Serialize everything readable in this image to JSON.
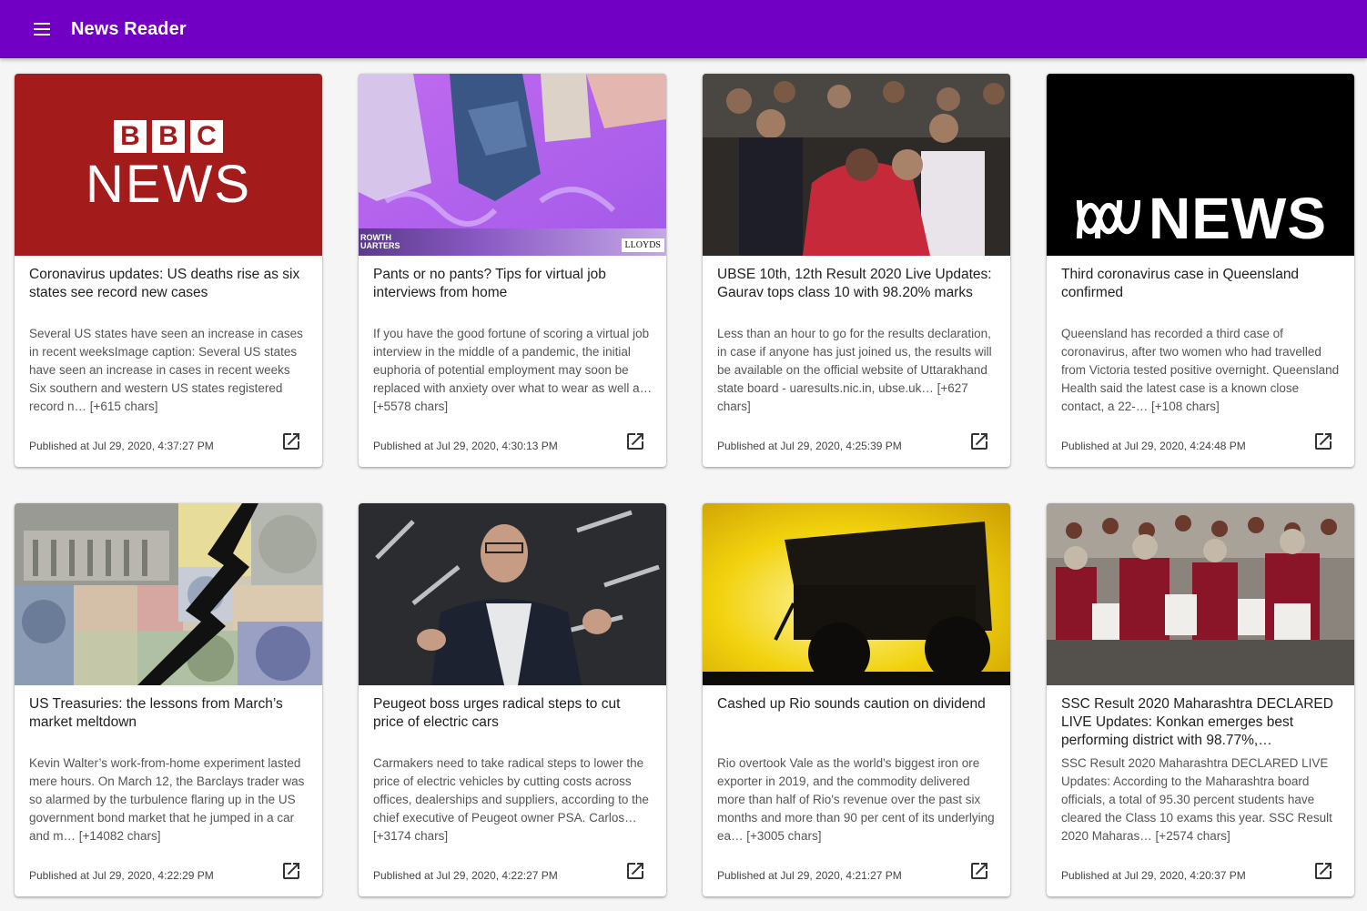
{
  "app": {
    "title": "News Reader",
    "accent": "#7200c4"
  },
  "articles": [
    {
      "title": "Coronavirus updates: US deaths rise as six states see record new cases",
      "description": "Several US states have seen an increase in cases in recent weeksImage caption: Several US states have seen an increase in cases in recent weeks Six southern and western US states registered record n… [+615 chars]",
      "published": "Published at Jul 29, 2020, 4:37:27 PM",
      "image_logo": {
        "blocks": [
          "B",
          "B",
          "C"
        ],
        "word": "NEWS"
      }
    },
    {
      "title": "Pants or no pants? Tips for virtual job interviews from home",
      "description": "If you have the good fortune of scoring a virtual job interview in the middle of a pandemic, the initial euphoria of potential employment may soon be replaced with anxiety over what to wear as well a… [+5578 chars]",
      "published": "Published at Jul 29, 2020, 4:30:13 PM",
      "image_logo": {
        "left": "ROWTH\nUARTERS",
        "right": "LLOYDS"
      }
    },
    {
      "title": "UBSE 10th, 12th Result 2020 Live Updates: Gaurav tops class 10 with 98.20% marks",
      "description": "Less than an hour to go for the results declaration, in case if anyone has just joined us, the results will be available on the official website of Uttarakhand state board - uaresults.nic.in, ubse.uk… [+627 chars]",
      "published": "Published at Jul 29, 2020, 4:25:39 PM"
    },
    {
      "title": "Third coronavirus case in Queensland confirmed",
      "description": "Queensland has recorded a third case of coronavirus, after two women who had travelled from Victoria tested positive overnight. Queensland Health said the latest case is a known close contact, a 22-… [+108 chars]",
      "published": "Published at Jul 29, 2020, 4:24:48 PM",
      "image_logo": {
        "word": "NEWS"
      }
    },
    {
      "title": "US Treasuries: the lessons from March’s market meltdown",
      "description": "Kevin Walter’s work-from-home experiment lasted mere hours. On March 12, the Barclays trader was so alarmed by the turbulence flaring up in the US government bond market that he jumped in a car and m… [+14082 chars]",
      "published": "Published at Jul 29, 2020, 4:22:29 PM"
    },
    {
      "title": "Peugeot boss urges radical steps to cut price of electric cars",
      "description": "Carmakers need to take radical steps to lower the price of electric vehicles by cutting costs across offices, dealerships and suppliers, according to the chief executive of Peugeot owner PSA. Carlos… [+3174 chars]",
      "published": "Published at Jul 29, 2020, 4:22:27 PM"
    },
    {
      "title": "Cashed up Rio sounds caution on dividend",
      "description": "Rio overtook Vale as the world's biggest iron ore exporter in 2019, and the commodity delivered more than half of Rio's revenue over the past six months and more than 90 per cent of its underlying ea… [+3005 chars]",
      "published": "Published at Jul 29, 2020, 4:21:27 PM"
    },
    {
      "title": "SSC Result 2020 Maharashtra DECLARED LIVE Updates: Konkan emerges best performing district with 98.77%,…",
      "description": "SSC Result 2020 Maharashtra DECLARED LIVE Updates: According to the Maharashtra board officials, a total of 95.30 percent students have cleared the Class 10 exams this year. SSC Result 2020 Maharas… [+2574 chars]",
      "published": "Published at Jul 29, 2020, 4:20:37 PM"
    }
  ]
}
